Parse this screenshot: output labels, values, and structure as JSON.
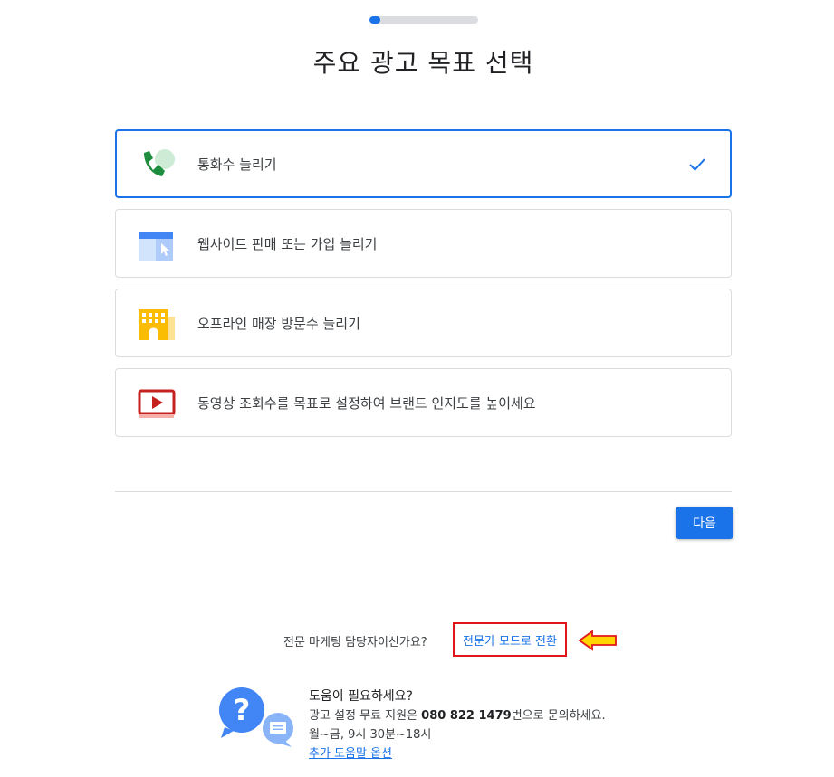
{
  "progress": {
    "fraction": 0.1
  },
  "page": {
    "title": "주요 광고 목표 선택"
  },
  "goals": [
    {
      "label": "통화수 늘리기",
      "icon": "phone-call-icon",
      "selected": true
    },
    {
      "label": "웹사이트 판매 또는 가입 늘리기",
      "icon": "website-click-icon",
      "selected": false
    },
    {
      "label": "오프라인 매장 방문수 늘리기",
      "icon": "store-building-icon",
      "selected": false
    },
    {
      "label": "동영상 조회수를 목표로 설정하여 브랜드 인지도를 높이세요",
      "icon": "video-play-icon",
      "selected": false
    }
  ],
  "actions": {
    "next_label": "다음"
  },
  "expert": {
    "question": "전문 마케팅 담당자이신가요?",
    "link": "전문가 모드로 전환"
  },
  "help": {
    "title": "도움이 필요하세요?",
    "phone_prefix": "광고 설정 무료 지원은 ",
    "phone_number": "080 822 1479",
    "phone_suffix": "번으로 문의하세요.",
    "hours_prefix": "월~금, ",
    "hours_time": "9시 30분~18시",
    "more_options": "추가 도움말 옵션"
  },
  "colors": {
    "accent": "#1a73e8",
    "highlight_box": "#e0161b",
    "arrow_fill": "#ffd400"
  }
}
